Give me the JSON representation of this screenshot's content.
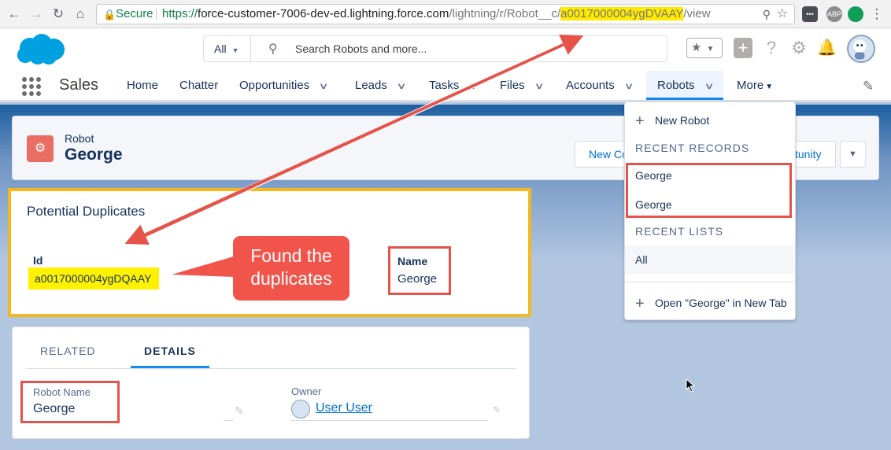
{
  "browser": {
    "secure_label": "Secure",
    "url_proto": "https://",
    "url_host": "force-customer-7006-dev-ed.lightning.force.com",
    "url_path_dim": "/lightning/r/Robot__c/",
    "url_id_highlight": "a0017000004ygDVAAY",
    "url_tail": "/view",
    "ext_label": "ABP"
  },
  "header": {
    "search_scope": "All",
    "search_placeholder": "Search Robots and more..."
  },
  "nav": {
    "app_name": "Sales",
    "items": [
      {
        "label": "Home"
      },
      {
        "label": "Chatter"
      },
      {
        "label": "Opportunities"
      },
      {
        "label": "Leads"
      },
      {
        "label": "Tasks"
      },
      {
        "label": "Files"
      },
      {
        "label": "Accounts"
      },
      {
        "label": "Robots"
      },
      {
        "label": "More"
      }
    ]
  },
  "record": {
    "object_label": "Robot",
    "name": "George",
    "btn_new_partial": "New Co",
    "btn_opp_partial": "tunity"
  },
  "duplicates": {
    "title": "Potential Duplicates",
    "id_header": "Id",
    "id_value": "a0017000004ygDQAAY",
    "name_header": "Name",
    "name_value": "George",
    "callout": "Found the duplicates"
  },
  "details": {
    "tab_related": "RELATED",
    "tab_details": "DETAILS",
    "robot_name_label": "Robot Name",
    "robot_name_value": "George",
    "owner_label": "Owner",
    "owner_value": "User User"
  },
  "dropdown": {
    "new_item": "New Robot",
    "recent_records_header": "RECENT RECORDS",
    "recent_records": [
      "George",
      "George"
    ],
    "recent_lists_header": "RECENT LISTS",
    "recent_lists": [
      "All"
    ],
    "open_new_tab": "Open \"George\" in New Tab"
  },
  "colors": {
    "brand": "#1589ee",
    "annotation_red": "#e6534a",
    "highlight_yellow": "#fff200",
    "duplicate_border": "#f5b81c"
  }
}
